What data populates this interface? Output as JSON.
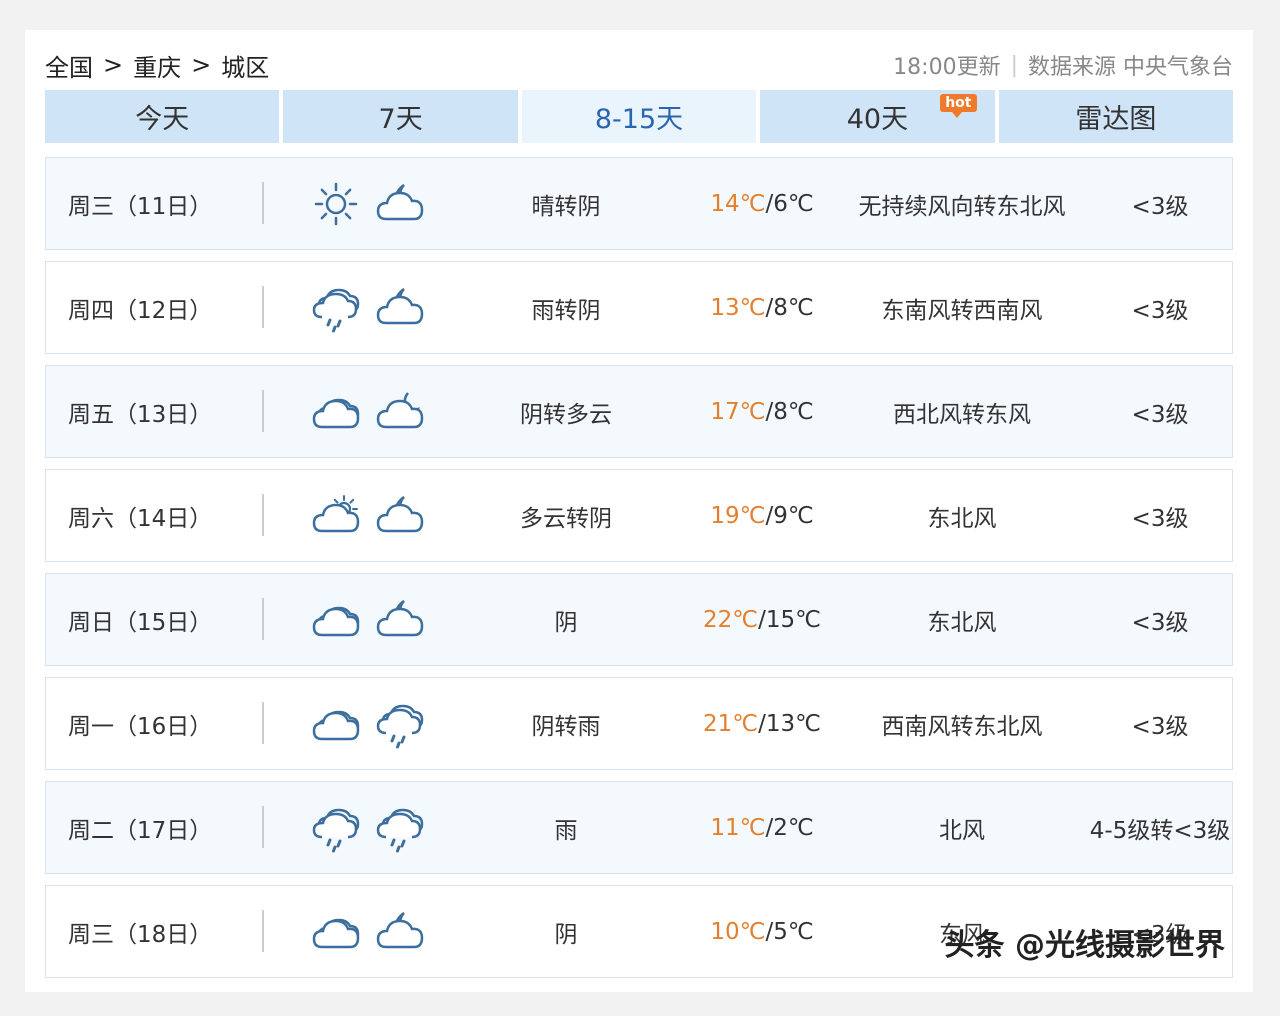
{
  "breadcrumb": {
    "items": [
      "全国",
      "重庆",
      "城区"
    ],
    "separator": ">"
  },
  "meta": {
    "updated": "18:00更新",
    "source": "数据来源 中央气象台"
  },
  "tabs": [
    {
      "label": "今天"
    },
    {
      "label": "7天"
    },
    {
      "label": "8-15天",
      "active": true
    },
    {
      "label": "40天",
      "badge": "hot"
    },
    {
      "label": "雷达图"
    }
  ],
  "forecast": [
    {
      "day": "周三（11日）",
      "icon_day": "sunny-icon",
      "icon_night": "cloudy-night-icon",
      "desc": "晴转阴",
      "high": "14℃",
      "low": "6℃",
      "wind": "无持续风向转东北风",
      "level": "<3级"
    },
    {
      "day": "周四（12日）",
      "icon_day": "rain-icon",
      "icon_night": "cloudy-night-icon",
      "desc": "雨转阴",
      "high": "13℃",
      "low": "8℃",
      "wind": "东南风转西南风",
      "level": "<3级"
    },
    {
      "day": "周五（13日）",
      "icon_day": "overcast-icon",
      "icon_night": "partly-cloudy-night-icon",
      "desc": "阴转多云",
      "high": "17℃",
      "low": "8℃",
      "wind": "西北风转东风",
      "level": "<3级"
    },
    {
      "day": "周六（14日）",
      "icon_day": "partly-cloudy-day-icon",
      "icon_night": "cloudy-night-icon",
      "desc": "多云转阴",
      "high": "19℃",
      "low": "9℃",
      "wind": "东北风",
      "level": "<3级"
    },
    {
      "day": "周日（15日）",
      "icon_day": "overcast-icon",
      "icon_night": "cloudy-night-icon",
      "desc": "阴",
      "high": "22℃",
      "low": "15℃",
      "wind": "东北风",
      "level": "<3级"
    },
    {
      "day": "周一（16日）",
      "icon_day": "overcast-icon",
      "icon_night": "rain-icon",
      "desc": "阴转雨",
      "high": "21℃",
      "low": "13℃",
      "wind": "西南风转东北风",
      "level": "<3级"
    },
    {
      "day": "周二（17日）",
      "icon_day": "rain-icon",
      "icon_night": "rain-icon",
      "desc": "雨",
      "high": "11℃",
      "low": "2℃",
      "wind": "北风",
      "level": "4-5级转<3级"
    },
    {
      "day": "周三（18日）",
      "icon_day": "overcast-icon",
      "icon_night": "cloudy-night-icon",
      "desc": "阴",
      "high": "10℃",
      "low": "5℃",
      "wind": "东风",
      "level": "<3级"
    }
  ],
  "watermark": "头条 @光线摄影世界",
  "colors": {
    "tab_bg": "#cfe4f7",
    "tab_active_bg": "#eaf4fd",
    "tab_active_text": "#2a66b0",
    "high_temp": "#e2802d",
    "icon_stroke": "#3d6f9d",
    "hot_badge": "#f07a2c"
  }
}
